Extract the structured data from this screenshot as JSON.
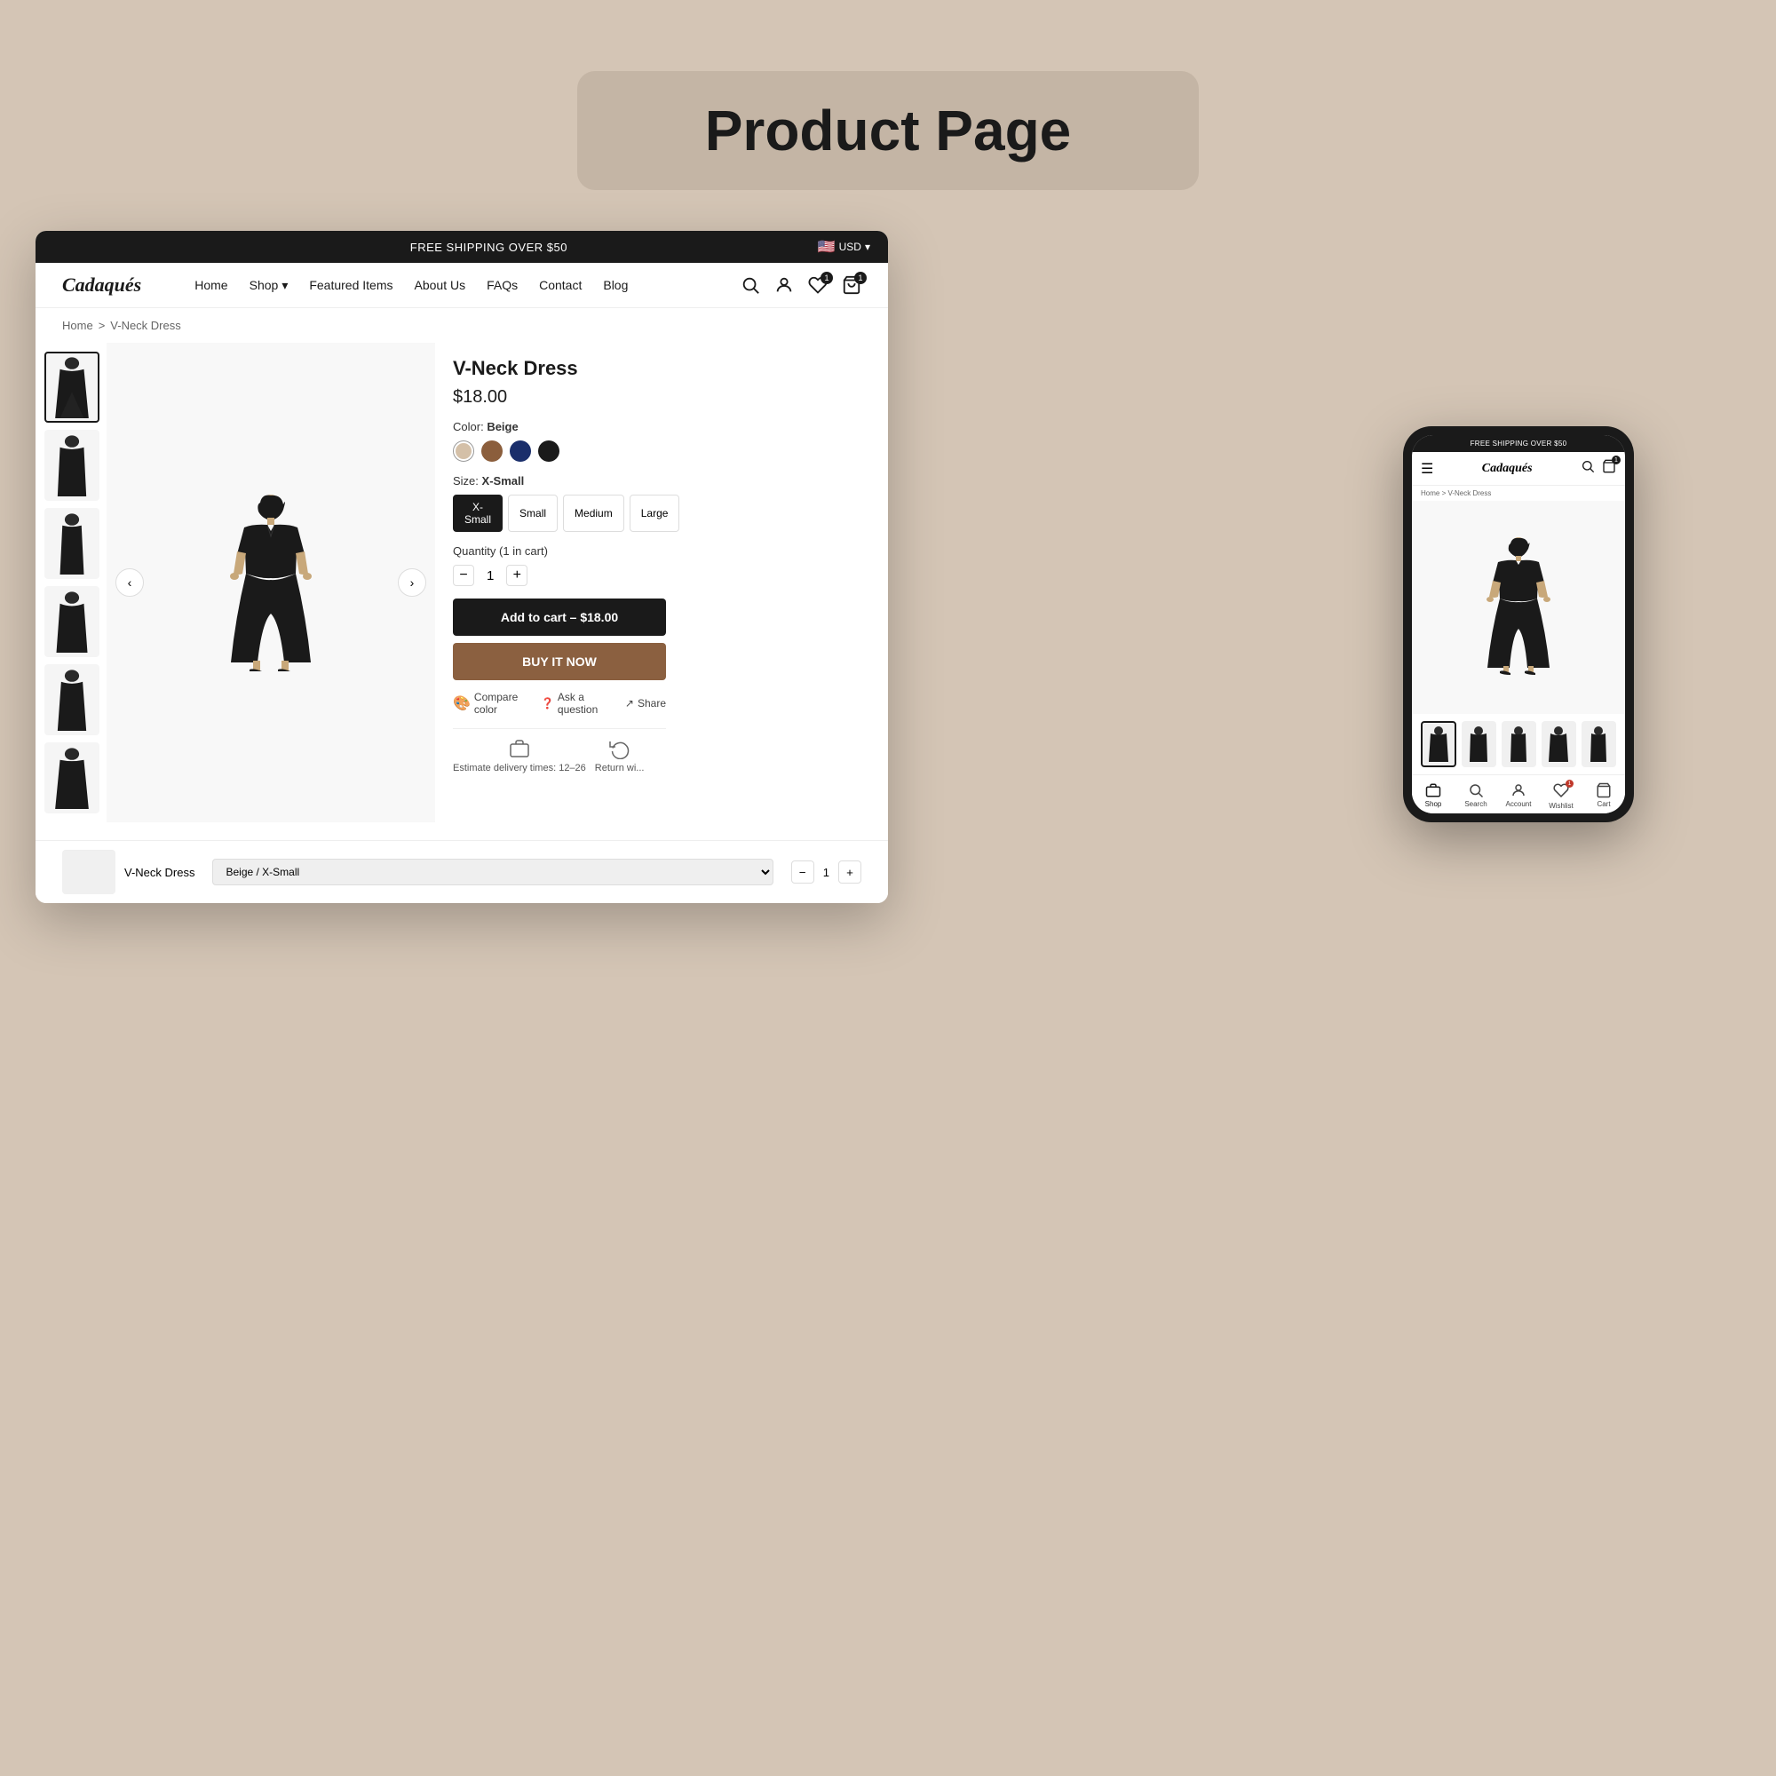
{
  "page": {
    "title": "Product Page",
    "bg_color": "#d4c5b5"
  },
  "browser": {
    "shipping_msg": "FREE SHIPPING OVER $50",
    "currency": "USD",
    "logo": "Cadaqués",
    "nav_links": [
      {
        "label": "Home",
        "has_dropdown": false
      },
      {
        "label": "Shop",
        "has_dropdown": true
      },
      {
        "label": "Featured Items",
        "has_dropdown": false
      },
      {
        "label": "About Us",
        "has_dropdown": false
      },
      {
        "label": "FAQs",
        "has_dropdown": false
      },
      {
        "label": "Contact",
        "has_dropdown": false
      },
      {
        "label": "Blog",
        "has_dropdown": false
      }
    ],
    "wishlist_count": "1",
    "cart_count": "1"
  },
  "breadcrumb": {
    "home": "Home",
    "separator": ">",
    "current": "V-Neck Dress"
  },
  "product": {
    "title": "V-Neck Dress",
    "price": "$18.00",
    "color_label": "Color:",
    "color_name": "Beige",
    "colors": [
      {
        "name": "beige",
        "hex": "#d4c0a8"
      },
      {
        "name": "brown",
        "hex": "#8b5e3c"
      },
      {
        "name": "navy",
        "hex": "#1a2e6b"
      },
      {
        "name": "black",
        "hex": "#1a1a1a"
      }
    ],
    "size_label": "Size:",
    "size_name": "X-Small",
    "sizes": [
      "X-Small",
      "Small",
      "Medium",
      "Large"
    ],
    "qty_label": "Quantity (1 in cart)",
    "qty": "1",
    "add_to_cart_btn": "Add to cart – $18.00",
    "buy_now_btn": "BUY IT NOW",
    "compare_color": "Compare color",
    "ask_question": "Ask a question",
    "share": "Share",
    "delivery_label": "Estimate delivery times: 12–26",
    "return_label": "Return wi..."
  },
  "sticky_bar": {
    "product_name": "V-Neck Dress",
    "variant": "Beige / X-Small",
    "qty": "1"
  },
  "mobile": {
    "shipping_msg": "FREE SHIPPING OVER $50",
    "logo": "Cadaqués",
    "breadcrumb": "Home > V-Neck Dress",
    "bottom_nav": [
      {
        "label": "Shop",
        "icon": "shop-icon"
      },
      {
        "label": "Search",
        "icon": "search-icon"
      },
      {
        "label": "Account",
        "icon": "account-icon"
      },
      {
        "label": "Wishlist",
        "icon": "heart-icon"
      },
      {
        "label": "Cart",
        "icon": "cart-icon"
      }
    ],
    "cart_badge": "1"
  }
}
